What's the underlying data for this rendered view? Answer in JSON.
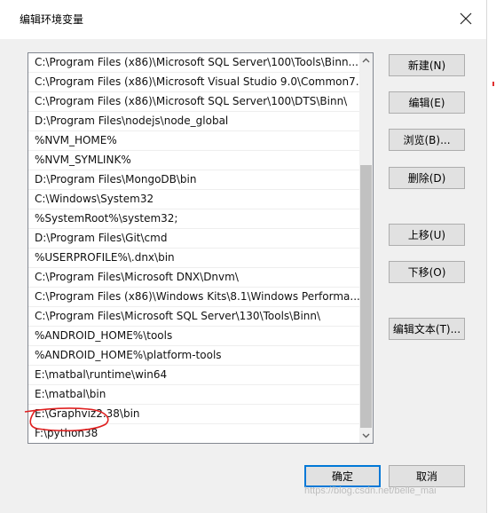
{
  "dialog": {
    "title": "编辑环境变量",
    "close_symbol": "✕"
  },
  "path_list": {
    "rows": [
      "C:\\Program Files (x86)\\Microsoft SQL Server\\100\\Tools\\Binn...",
      "C:\\Program Files (x86)\\Microsoft Visual Studio 9.0\\Common7...",
      "C:\\Program Files (x86)\\Microsoft SQL Server\\100\\DTS\\Binn\\",
      "D:\\Program Files\\nodejs\\node_global",
      "%NVM_HOME%",
      "%NVM_SYMLINK%",
      "D:\\Program Files\\MongoDB\\bin",
      "C:\\Windows\\System32",
      "%SystemRoot%\\system32;",
      "D:\\Program Files\\Git\\cmd",
      "%USERPROFILE%\\.dnx\\bin",
      "C:\\Program Files\\Microsoft DNX\\Dnvm\\",
      "C:\\Program Files (x86)\\Windows Kits\\8.1\\Windows Performa...",
      "C:\\Program Files\\Microsoft SQL Server\\130\\Tools\\Binn\\",
      "%ANDROID_HOME%\\tools",
      "%ANDROID_HOME%\\platform-tools",
      "E:\\matbal\\runtime\\win64",
      "E:\\matbal\\bin",
      "E:\\Graphviz2.38\\bin",
      "F:\\python38",
      ""
    ]
  },
  "buttons": {
    "new": "新建(N)",
    "edit": "编辑(E)",
    "browse": "浏览(B)...",
    "delete": "删除(D)",
    "move_up": "上移(U)",
    "move_down": "下移(O)",
    "edit_text": "编辑文本(T)...",
    "ok": "确定",
    "cancel": "取消"
  },
  "watermark": "https://blog.csdn.net/belle_mai",
  "colors": {
    "annotation_red": "#e02020",
    "default_button_border": "#0078d7"
  }
}
